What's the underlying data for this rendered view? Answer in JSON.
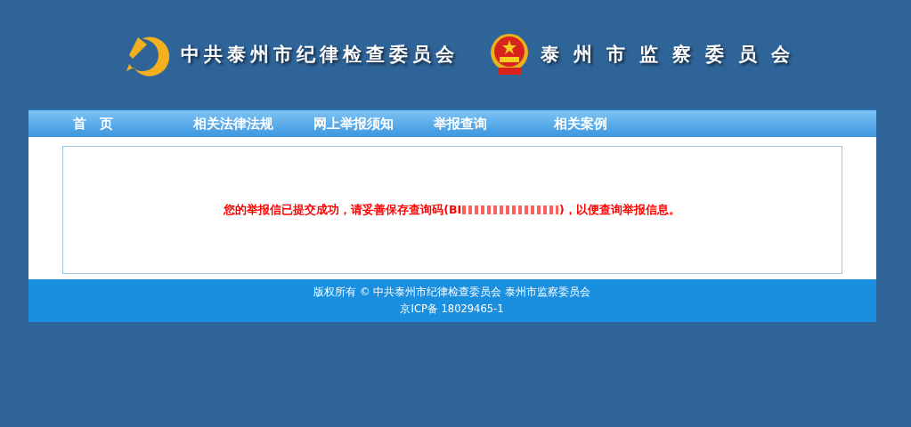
{
  "header": {
    "titles": [
      {
        "kind": "party",
        "text": "中共泰州市纪律检查委员会"
      },
      {
        "kind": "state",
        "text": "泰州市监察委员会"
      }
    ]
  },
  "nav": {
    "items": [
      {
        "label": "首　页"
      },
      {
        "label": "相关法律法规"
      },
      {
        "label": "网上举报须知"
      },
      {
        "label": "举报查询"
      },
      {
        "label": "相关案例"
      }
    ]
  },
  "message": {
    "before": "您的举报信已提交成功，请妥善保存查询码(BI",
    "after": ")，以便查询举报信息。",
    "code_redacted": true
  },
  "footer": {
    "lines": [
      "版权所有 © 中共泰州市纪律检查委员会 泰州市监察委员会",
      "京ICP备 18029465-1"
    ]
  }
}
